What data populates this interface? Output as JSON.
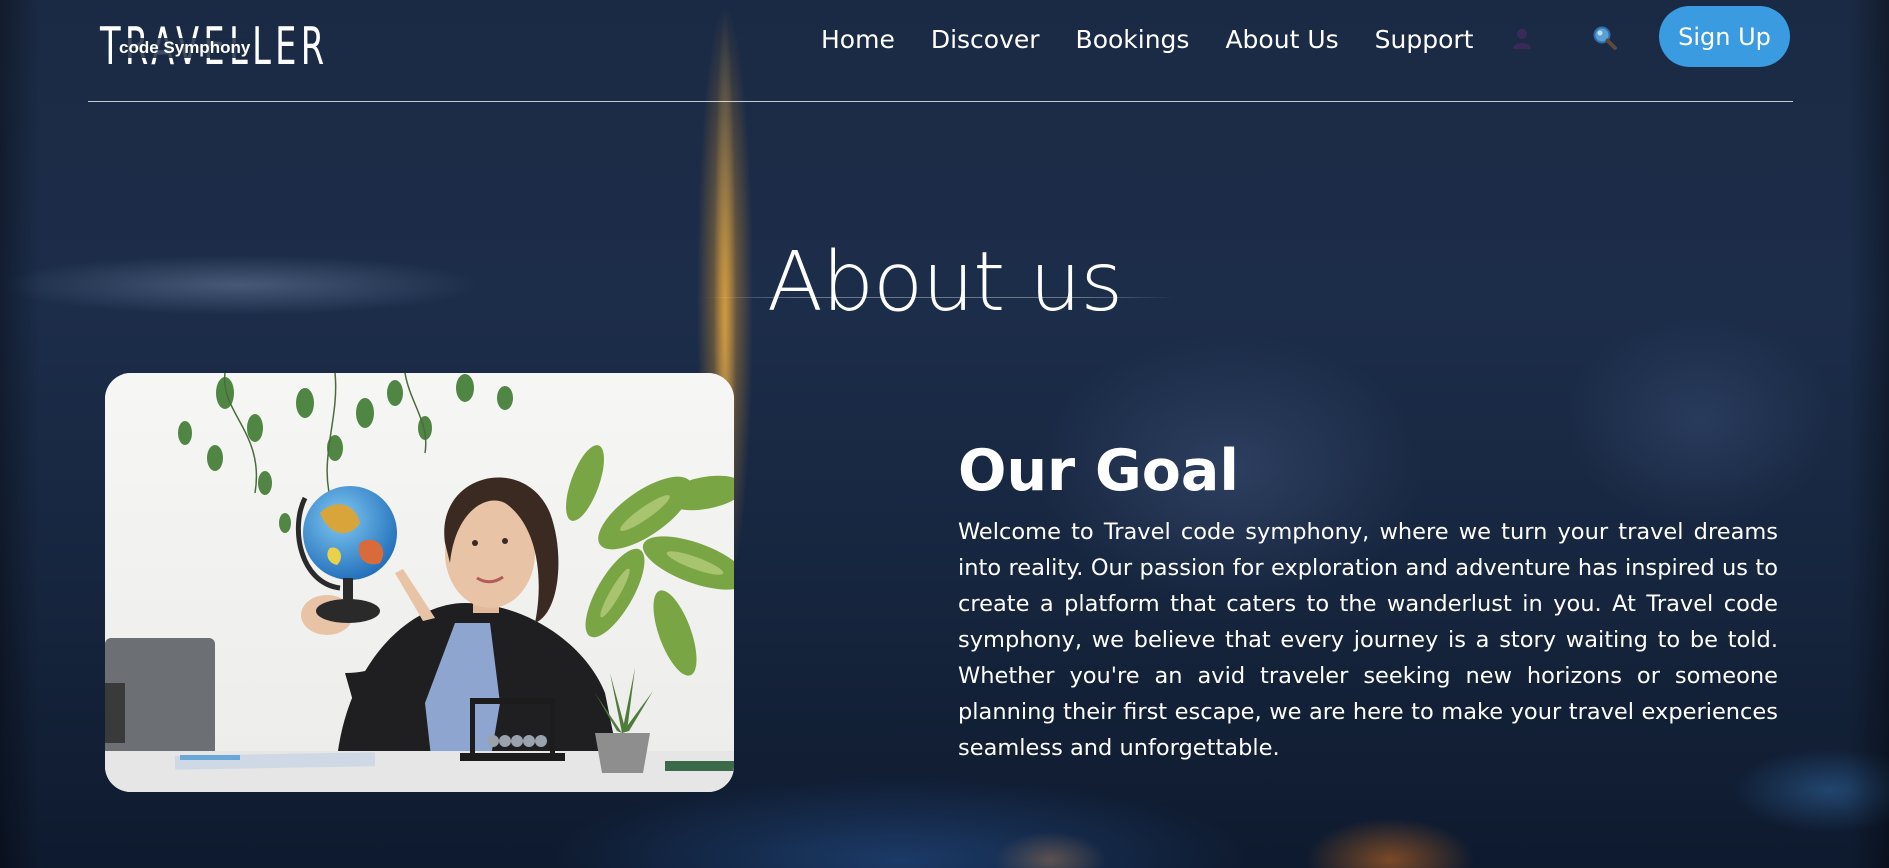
{
  "brand": {
    "logo_word": "TRAVELLER",
    "logo_sub": "code Symphony"
  },
  "nav": {
    "links": [
      "Home",
      "Discover",
      "Bookings",
      "About Us",
      "Support"
    ],
    "user_icon": "user-icon",
    "search_icon": "search-icon",
    "signup_label": "Sign Up"
  },
  "hero": {
    "title": "About us"
  },
  "goal": {
    "title": "Our Goal",
    "body": "Welcome to Travel code symphony, where we turn your travel dreams into reality. Our passion for exploration and adventure has inspired us to create a platform that caters to the wanderlust in you. At Travel code symphony, we believe that every journey is a story waiting to be told. Whether you're an avid traveler seeking new horizons or someone planning their first escape, we are here to make your travel experiences seamless and unforgettable."
  },
  "colors": {
    "accent": "#3a9be0",
    "background": "#1b2a44",
    "text": "#ffffff"
  }
}
